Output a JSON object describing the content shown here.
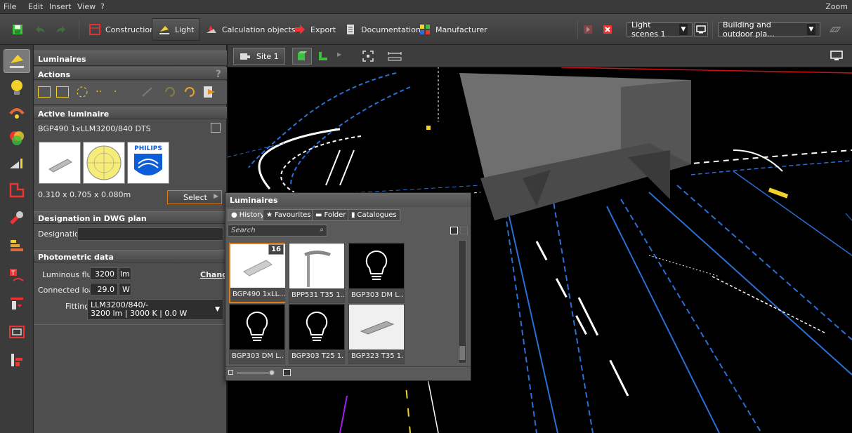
{
  "menu": {
    "items": [
      "File",
      "Edit",
      "Insert",
      "View",
      "?"
    ],
    "zoom_label": "Zoom"
  },
  "toolbar": {
    "construction": "Construction",
    "light": "Light",
    "calculation_objects": "Calculation objects",
    "export": "Export",
    "documentation": "Documentation",
    "manufacturer": "Manufacturer",
    "light_scenes": "Light scenes 1",
    "building_dropdown": "Building and outdoor pla..."
  },
  "panel": {
    "title": "Luminaires",
    "actions_header": "Actions",
    "help": "?",
    "active_header": "Active luminaire",
    "luminaire_name": "BGP490 1xLLM3200/840 DTS",
    "brand": "PHILIPS",
    "dimensions": "0.310 x 0.705 x 0.080m",
    "select_button": "Select",
    "designation_header": "Designation in DWG plan",
    "designation_label": "Designation",
    "designation_value": "",
    "photometric_header": "Photometric data",
    "flux_label": "Luminous flux",
    "flux_value": "3200",
    "flux_unit": "lm",
    "change_link": "Change",
    "load_label": "Connected load",
    "load_value": "29.0",
    "load_unit": "W",
    "fitting_label": "Fitting",
    "fitting_line1": "LLM3200/840/-",
    "fitting_line2": "3200 lm  |  3000 K  |  0.0 W"
  },
  "viewport": {
    "site_label": "Site 1"
  },
  "popup": {
    "title": "Luminaires",
    "tabs": [
      "History",
      "Favourites",
      "Folder",
      "Catalogues"
    ],
    "search_placeholder": "Search",
    "badge": "16",
    "items": [
      {
        "label": "BGP490 1xLL..."
      },
      {
        "label": "BPP531 T35 1..."
      },
      {
        "label": "BGP303 DM L..."
      },
      {
        "label": "BGP303 DM L..."
      },
      {
        "label": "BGP303 T25 1..."
      },
      {
        "label": "BGP323 T35 1..."
      }
    ]
  },
  "colors": {
    "accent_orange": "#e07b1a",
    "road_blue": "#2a6fd6",
    "green_icon": "#3fbf3f"
  }
}
